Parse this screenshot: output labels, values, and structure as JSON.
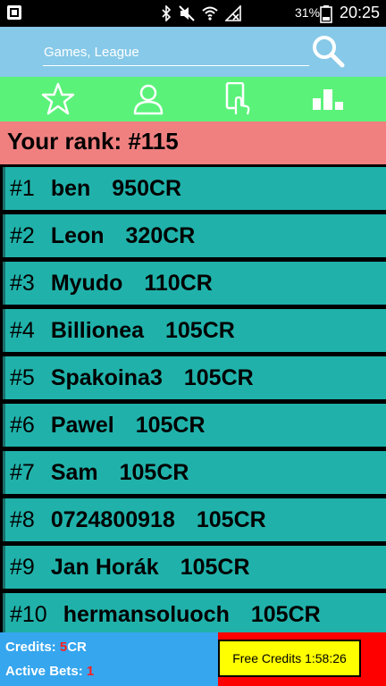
{
  "status_bar": {
    "battery_percent": "31%",
    "time": "20:25",
    "icons": [
      "notification-icon",
      "bluetooth-icon",
      "mute-icon",
      "wifi-icon",
      "no-signal-icon",
      "battery-icon"
    ]
  },
  "search": {
    "placeholder": "Games, League",
    "icon": "search-icon"
  },
  "tabs": [
    {
      "name": "favorites",
      "icon": "star-icon"
    },
    {
      "name": "profile",
      "icon": "user-icon"
    },
    {
      "name": "bets",
      "icon": "phone-touch-icon"
    },
    {
      "name": "leaderboard",
      "icon": "podium-icon"
    }
  ],
  "rank": {
    "label": "Your rank: #115"
  },
  "leaderboard": {
    "rows": [
      {
        "rank": "#1",
        "name": "ben",
        "credits": "950CR"
      },
      {
        "rank": "#2",
        "name": "Leon",
        "credits": "320CR"
      },
      {
        "rank": "#3",
        "name": "Myudo",
        "credits": "110CR"
      },
      {
        "rank": "#4",
        "name": "Billionea",
        "credits": "105CR"
      },
      {
        "rank": "#5",
        "name": "Spakoina3",
        "credits": "105CR"
      },
      {
        "rank": "#6",
        "name": "Pawel",
        "credits": "105CR"
      },
      {
        "rank": "#7",
        "name": "Sam",
        "credits": "105CR"
      },
      {
        "rank": "#8",
        "name": "0724800918",
        "credits": "105CR"
      },
      {
        "rank": "#9",
        "name": "Jan Horák",
        "credits": "105CR"
      },
      {
        "rank": "#10",
        "name": "hermansoluoch",
        "credits": "105CR"
      }
    ]
  },
  "footer": {
    "credits_label": "Credits: ",
    "credits_value": "5",
    "credits_unit": "CR",
    "bets_label": "Active Bets: ",
    "bets_value": "1",
    "free_credits_button": "Free Credits 1:58:26"
  },
  "colors": {
    "search_bg": "#87c9e8",
    "tab_bar_bg": "#5bf27a",
    "rank_header_bg": "#f08080",
    "row_bg": "#20b2aa",
    "footer_left_bg": "#36a6ee",
    "footer_right_bg": "#ff0000",
    "button_bg": "#ffff00",
    "highlight_red": "#ff1e1e"
  }
}
